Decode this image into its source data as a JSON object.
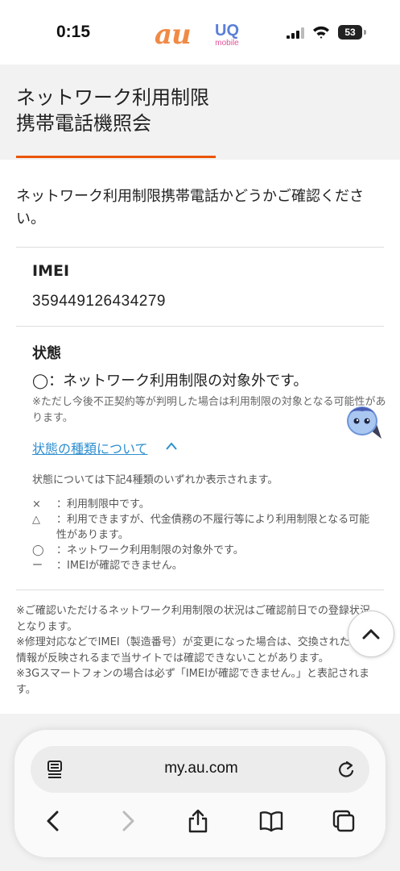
{
  "status_bar": {
    "time": "0:15",
    "brand_au": "au",
    "brand_uq": "UQ",
    "brand_uq_sub": "mobile",
    "battery": "53"
  },
  "header": {
    "title_line1": "ネットワーク利用制限",
    "title_line2": "携帯電話機照会",
    "accent_color": "#eb5505"
  },
  "intro": "ネットワーク利用制限携帯電話かどうかご確認ください。",
  "imei": {
    "label": "IMEI",
    "value": "359449126434279"
  },
  "status": {
    "label": "状態",
    "value": "◯：ネットワーク利用制限の対象外です。",
    "note": "※ただし今後不正契約等が判明した場合は利用制限の対象となる可能性があります。"
  },
  "status_types": {
    "link_label": "状態の種類について",
    "intro": "状態については下記4種類のいずれか表示されます。",
    "items": [
      {
        "symbol": "×",
        "text": "：利用制限中です。"
      },
      {
        "symbol": "△",
        "text": "：利用できますが、代金債務の不履行等により利用制限となる可能性があります。"
      },
      {
        "symbol": "◯",
        "text": "：ネットワーク利用制限の対象外です。"
      },
      {
        "symbol": "ー",
        "text": "：IMEIが確認できません。"
      }
    ]
  },
  "footnotes": [
    "※ご確認いただけるネットワーク利用制限の状況はご確認前日での登録状況となります。",
    "※修理対応などでIMEI（製造番号）が変更になった場合は、交換された旨の情報が反映されるまで当サイトでは確認できないことがあります。",
    "※3Gスマートフォンの場合は必ず「IMEIが確認できません。」と表記されます。"
  ],
  "browser": {
    "url": "my.au.com",
    "icons": [
      "reader-icon",
      "reload-icon",
      "back-icon",
      "forward-icon",
      "share-icon",
      "bookmarks-icon",
      "tabs-icon"
    ]
  }
}
